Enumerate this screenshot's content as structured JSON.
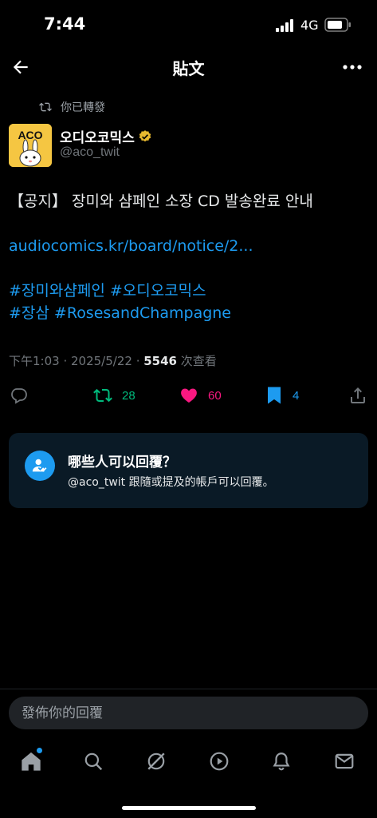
{
  "status_bar": {
    "time": "7:44",
    "network": "4G"
  },
  "header": {
    "title": "貼文",
    "back_icon": "arrow-left-icon",
    "more_icon": "more-horizontal-icon"
  },
  "repost": {
    "label": "你已轉發"
  },
  "author": {
    "name": "오디오코믹스",
    "handle": "@aco_twit",
    "avatar_text": "ACO",
    "verified": true
  },
  "post": {
    "title": "【공지】 장미와 샴페인 소장 CD 발송완료 안내",
    "link": "audiocomics.kr/board/notice/2...",
    "hashtags_line1": "#장미와샴페인 #오디오코믹스",
    "hashtags_line2": "#장삼 #RosesandChampagne"
  },
  "meta": {
    "time": "下午1:03",
    "date": "2025/5/22",
    "views": "5546",
    "views_label": "次查看"
  },
  "actions": {
    "reposts": "28",
    "likes": "60",
    "bookmarks": "4"
  },
  "reply_restriction": {
    "title": "哪些人可以回覆？",
    "text": "@aco_twit 跟隨或提及的帳戶可以回覆。"
  },
  "reply_box": {
    "placeholder": "發佈你的回覆"
  },
  "colors": {
    "accent": "#1d9bf0",
    "repost": "#00ba7c",
    "like": "#f91880",
    "background": "#000000"
  }
}
